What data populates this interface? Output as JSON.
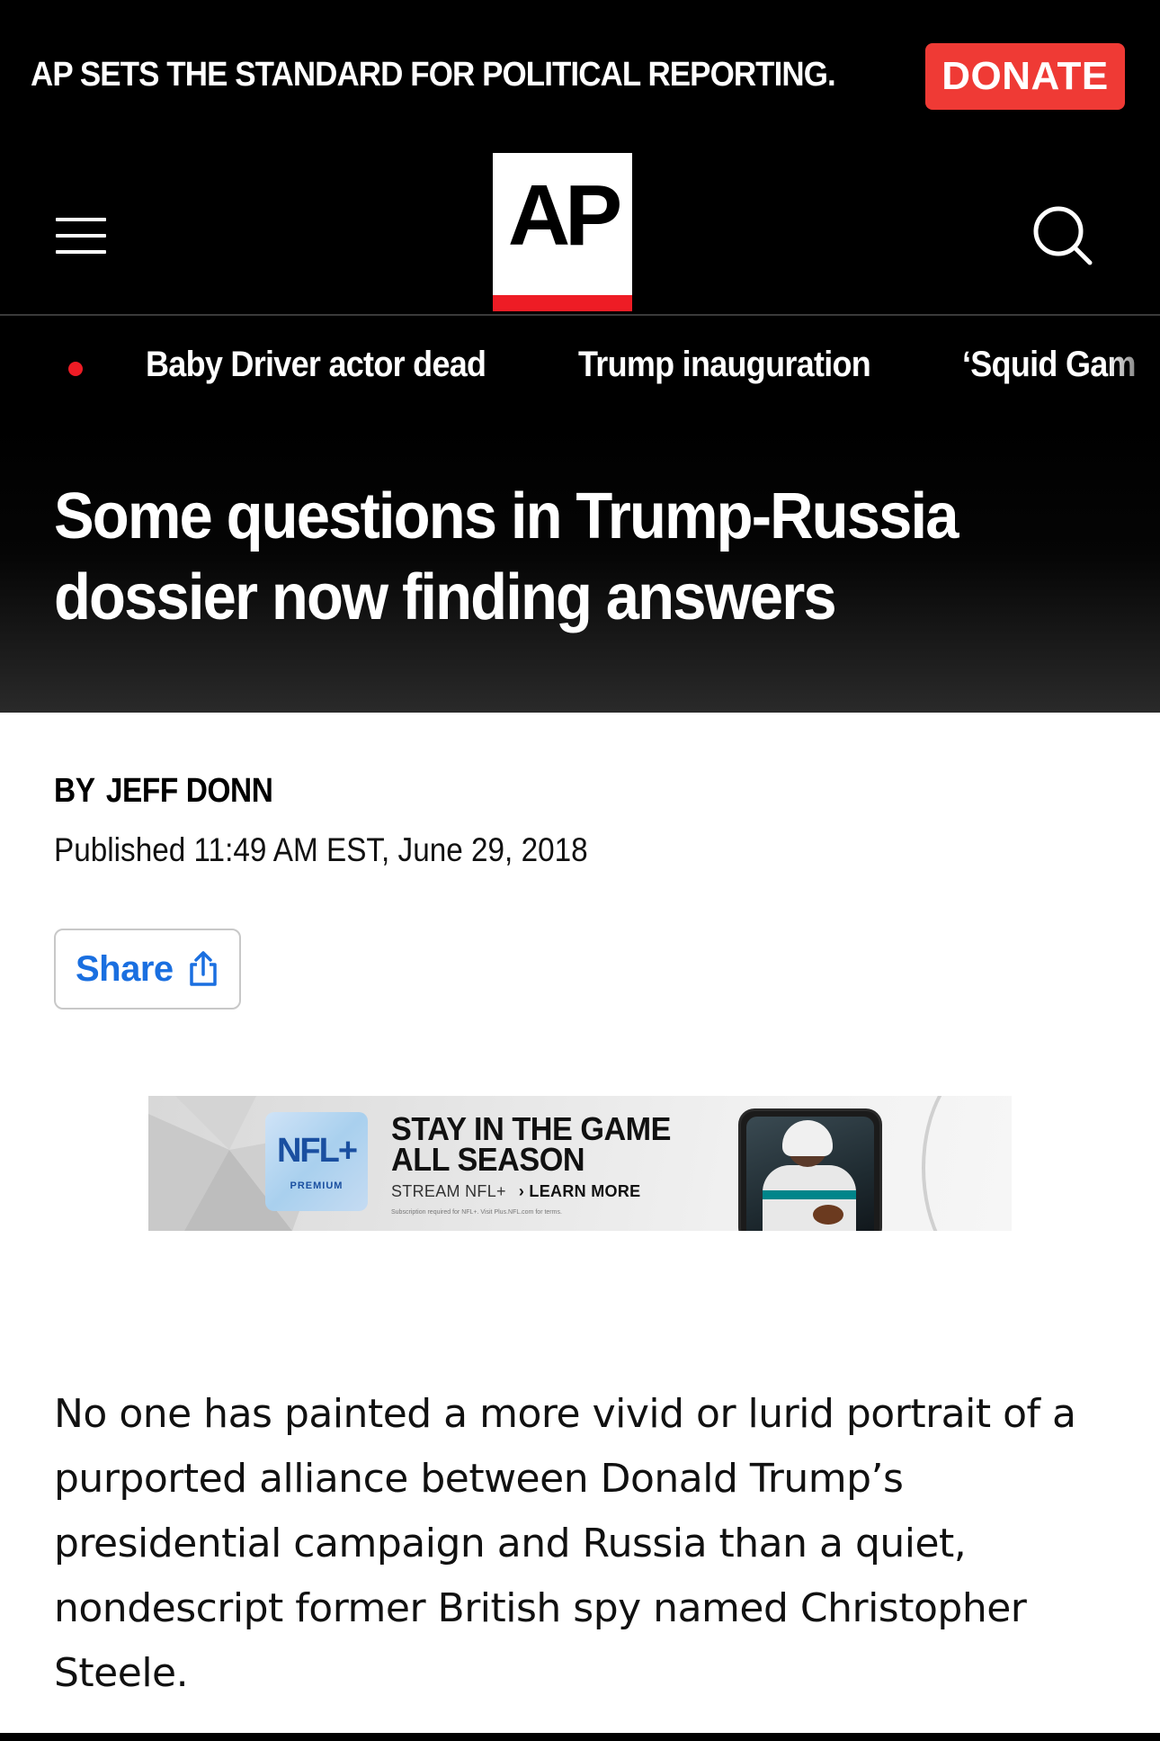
{
  "promo": {
    "text": "AP SETS THE STANDARD FOR POLITICAL REPORTING.",
    "donate_label": "DONATE"
  },
  "header": {
    "logo_text": "AP",
    "menu_icon": "hamburger-menu-icon",
    "search_icon": "search-icon"
  },
  "trending": {
    "items": [
      {
        "label": "Baby Driver actor dead"
      },
      {
        "label": "Trump inauguration"
      },
      {
        "label": "‘Squid Gam"
      }
    ]
  },
  "article": {
    "headline": "Some questions in Trump-Russia dossier now finding answers",
    "byline_prefix": "BY",
    "author": "JEFF DONN",
    "published": "Published 11:49 AM EST, June 29, 2018",
    "share_label": "Share",
    "body": "No one has painted a more vivid or lurid portrait of a purported alliance between Donald Trump’s presidential campaign and Russia than a quiet, nondescript former British spy named Christopher Steele."
  },
  "ad": {
    "brand": "NFL+",
    "brand_sub": "PREMIUM",
    "headline_line1": "STAY IN THE GAME",
    "headline_line2": "ALL SEASON",
    "cta_prefix": "STREAM NFL+",
    "cta": "› LEARN MORE",
    "fine_print": "Subscription required for NFL+. Visit Plus.NFL.com for terms."
  },
  "colors": {
    "brand_red": "#ee1c25",
    "donate_bg": "#ef3a35",
    "share_blue": "#1a6fe0",
    "header_bg": "#000000"
  }
}
